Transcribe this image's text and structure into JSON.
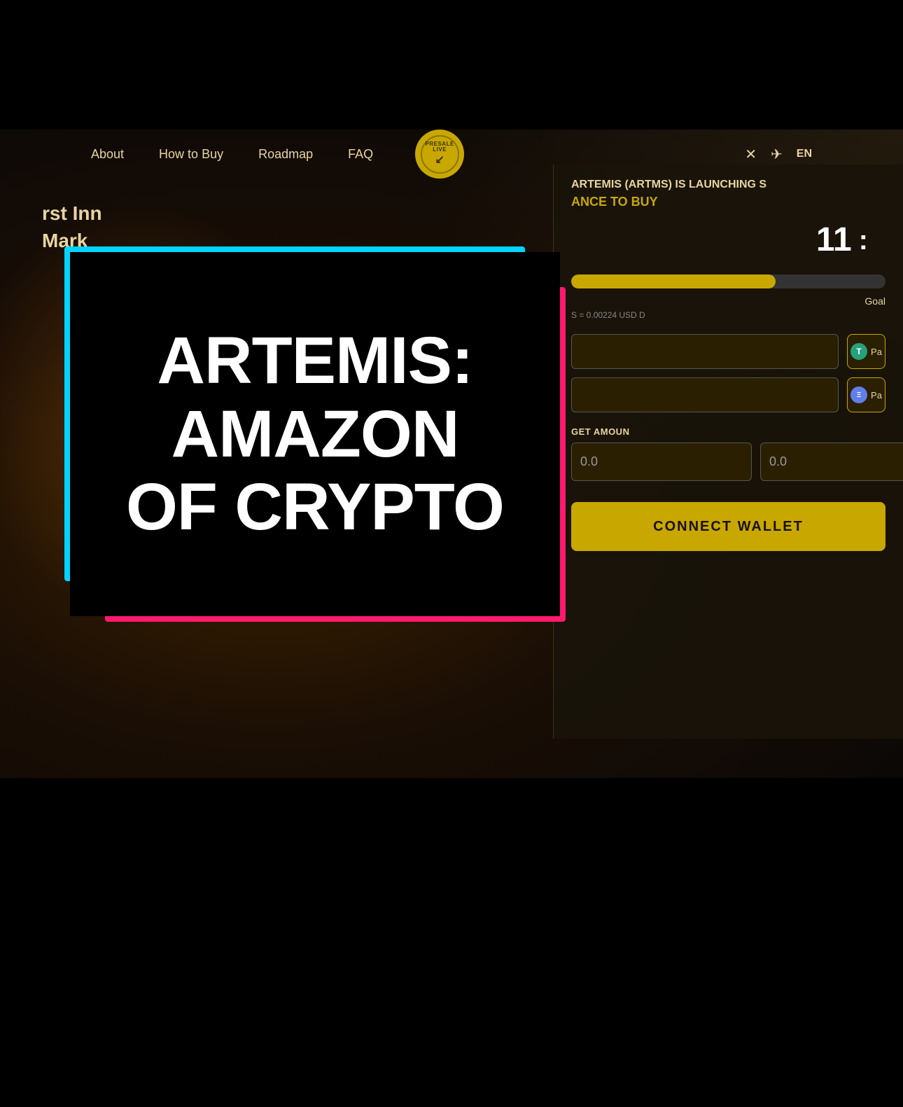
{
  "blackBars": {
    "top": "top black bar",
    "bottom": "bottom black bar"
  },
  "navbar": {
    "links": [
      {
        "label": "About",
        "id": "about"
      },
      {
        "label": "How to Buy",
        "id": "how-to-buy"
      },
      {
        "label": "Roadmap",
        "id": "roadmap"
      },
      {
        "label": "FAQ",
        "id": "faq"
      }
    ],
    "presaleBadge": {
      "line1": "PRESALE",
      "line2": "LIVE",
      "arrow": "↙"
    },
    "rightIcons": [
      "✕",
      "✈"
    ],
    "language": "EN"
  },
  "leftHero": {
    "line1": "rst Inn",
    "line2": "Mark"
  },
  "rightPanel": {
    "launching": "ARTEMIS (ARTMS) IS LAUNCHING S",
    "chance": "ANCE TO BUY",
    "timer": {
      "minutes": "11",
      "colon": ":"
    },
    "goal": {
      "label": "Goal",
      "rate": "S = 0.00224 USD D"
    },
    "payButton1": {
      "tokenLabel": "Pa"
    },
    "payButton2": {
      "tokenLabel": "Pa"
    },
    "amountLabel": "GET AMOUN",
    "amountValue1": "0.0",
    "amountValue2": "0.0",
    "connectWallet": "CONNECT WALLET"
  },
  "overlayCard": {
    "line1": "ARTEMIS:",
    "line2": "AMAZON",
    "line3": "OF CRYPTO",
    "borderCyan": "#00d4ff",
    "borderPink": "#ff1a6e"
  }
}
